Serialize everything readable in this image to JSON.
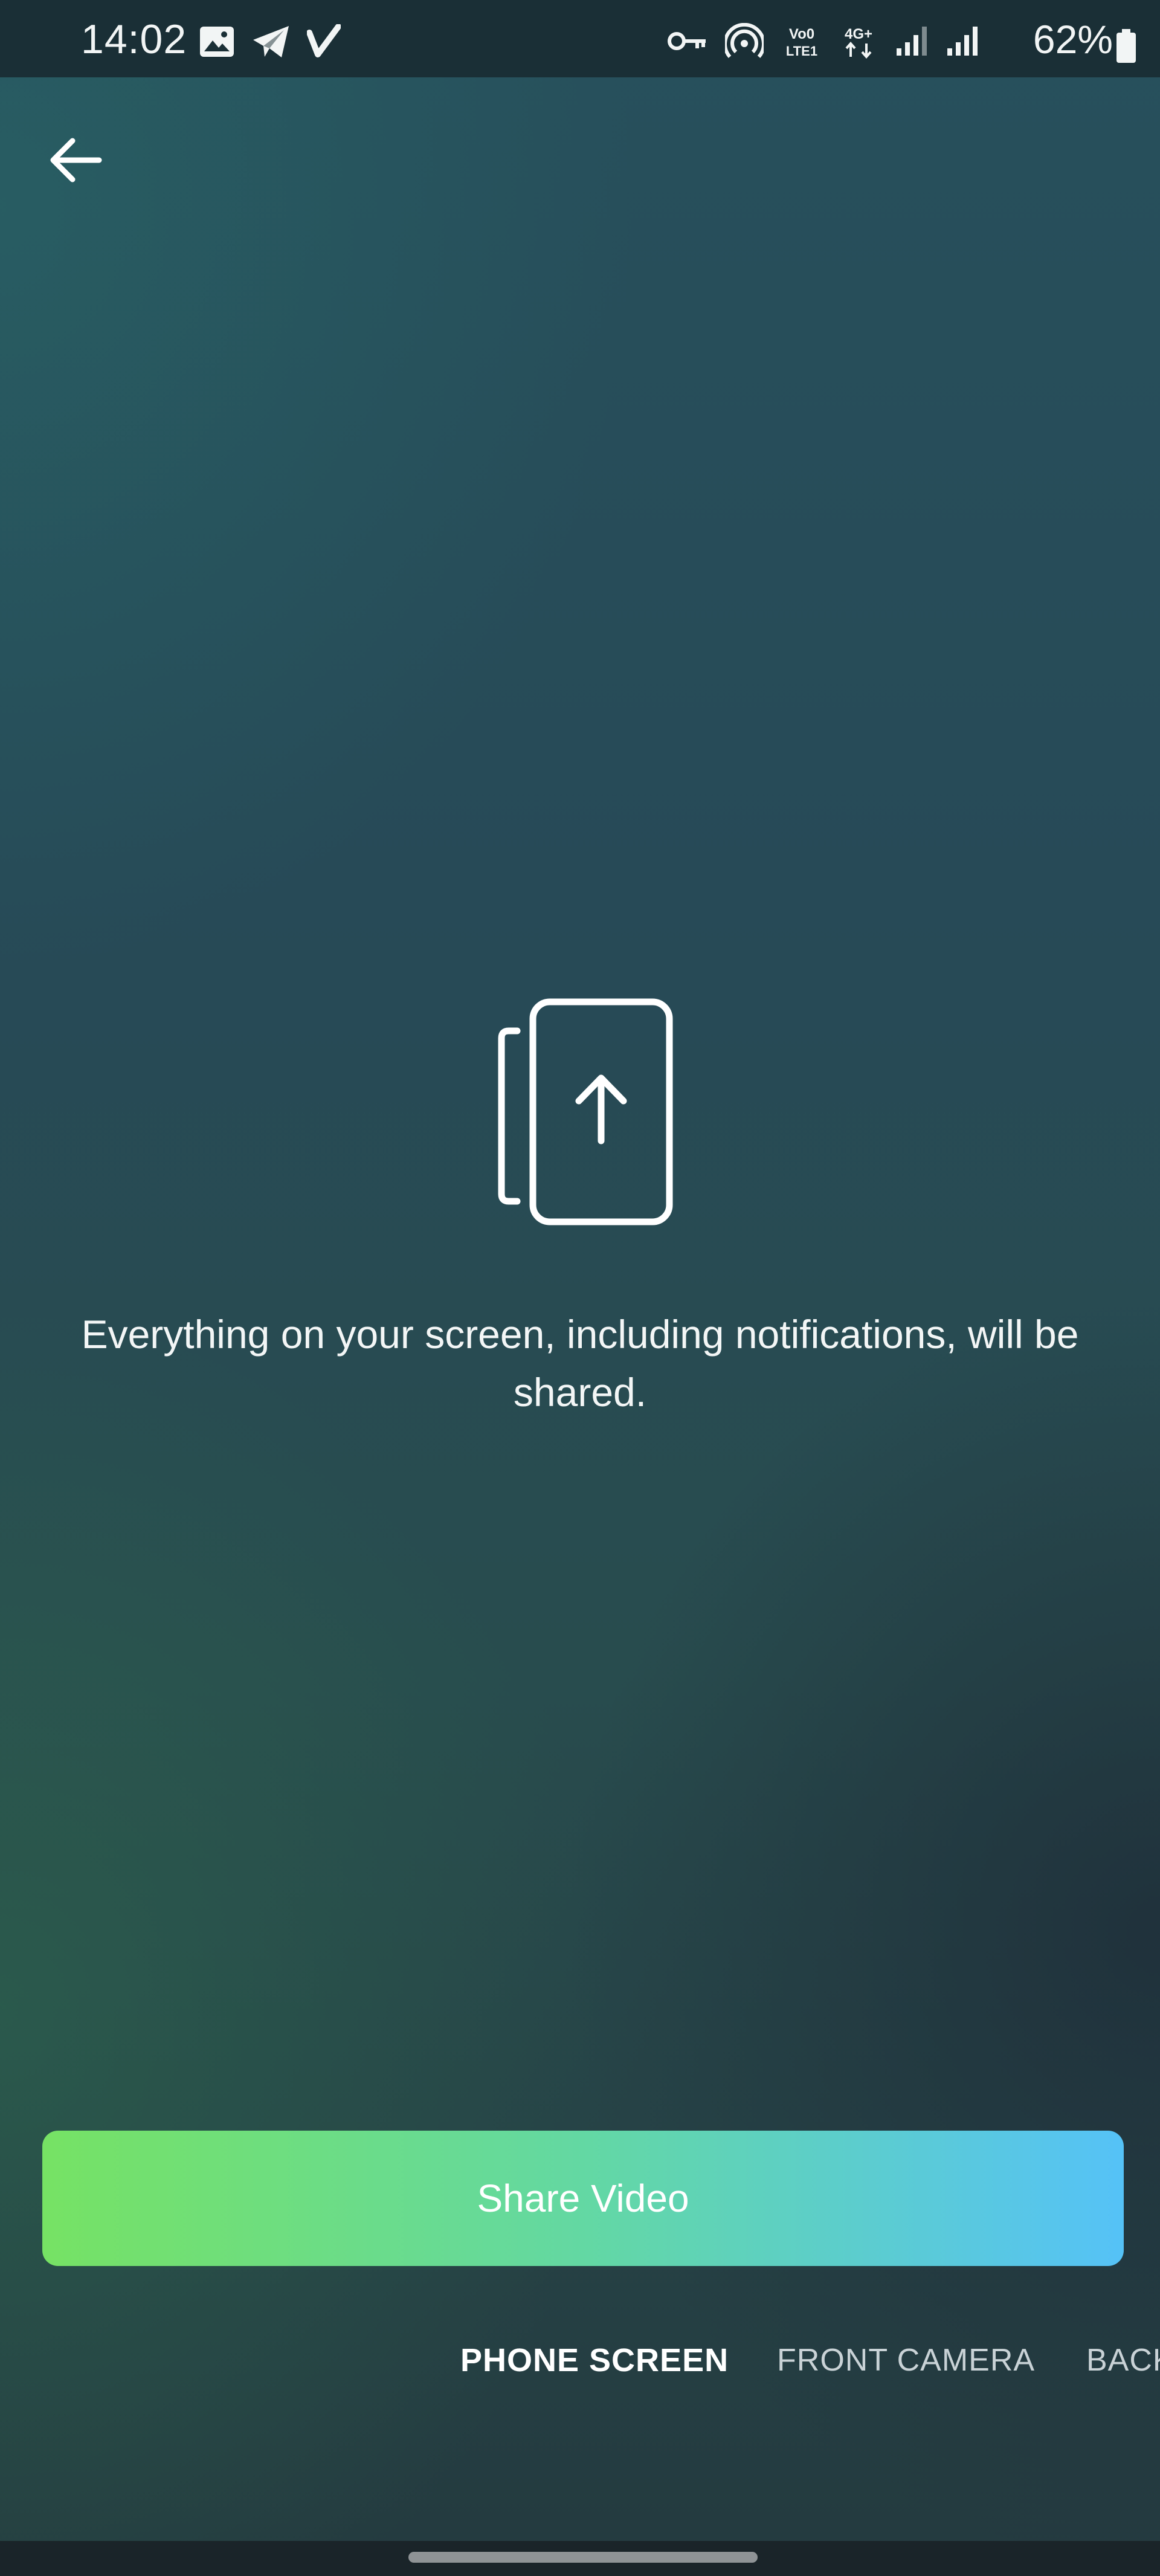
{
  "status_bar": {
    "time": "14:02",
    "battery_percent": "62%",
    "left_icons": [
      "gallery-icon",
      "telegram-icon",
      "vpn-check-icon"
    ],
    "right_icons": [
      "key-icon",
      "hotspot-icon",
      "volte-icon",
      "4g-icon",
      "signal-icon",
      "signal-icon",
      "battery-icon"
    ],
    "network_labels": {
      "volte": "Vo0 LTE1",
      "data": "4G+"
    }
  },
  "header": {
    "back_icon": "arrow-left-icon"
  },
  "main": {
    "illustration_icon": "screen-share-upload-icon",
    "description": "Everything on your screen, including notifications, will be shared."
  },
  "share_button": {
    "label": "Share Video"
  },
  "source_tabs": [
    {
      "label": "PHONE SCREEN",
      "selected": true
    },
    {
      "label": "FRONT CAMERA",
      "selected": false
    },
    {
      "label": "BACK",
      "selected": false
    }
  ],
  "colors": {
    "button_gradient_start": "#76e264",
    "button_gradient_end": "#55c2f7",
    "status_bar_bg": "#1a2f36"
  }
}
